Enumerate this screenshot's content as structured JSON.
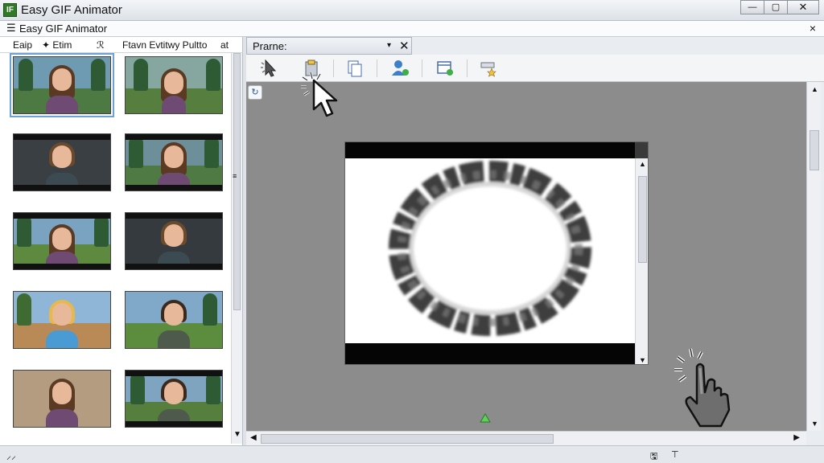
{
  "window": {
    "title": "Easy GIF Animator",
    "app_icon_text": "IF",
    "min": "—",
    "max": "▢",
    "close": "✕"
  },
  "menubar": {
    "icon": "☰",
    "title": "Easy GIF Animator",
    "close": "×"
  },
  "left_panel": {
    "tabs": [
      "Eaip",
      "✦ Etim",
      "ℛ",
      "Ftavn Evtitwy Pultto",
      "at"
    ],
    "scroll_up": "▲",
    "scroll_down": "▼",
    "grip": "≡"
  },
  "frame_panel": {
    "title": "Prarne:",
    "dropdown": "▾",
    "close": "✕"
  },
  "toolbar": {
    "tools": [
      "cursor-tool-icon",
      "paste-frame-icon",
      "copy-frame-icon",
      "add-user-icon",
      "insert-frame-icon",
      "effects-icon"
    ]
  },
  "canvas": {
    "rotate_button": "↻"
  },
  "preview": {
    "scroll_up": "▲",
    "scroll_down": "▼"
  },
  "scrollbars": {
    "up": "▲",
    "down": "▼",
    "left": "◀",
    "right": "▶",
    "grip": "≡"
  },
  "statusbar": {
    "left": "⸝⸝",
    "icon1": "🖫",
    "icon2": "⊤"
  },
  "colors": {
    "accent": "#6aa1da",
    "canvas": "#8c8c8c",
    "preview_bar": "#050505"
  }
}
